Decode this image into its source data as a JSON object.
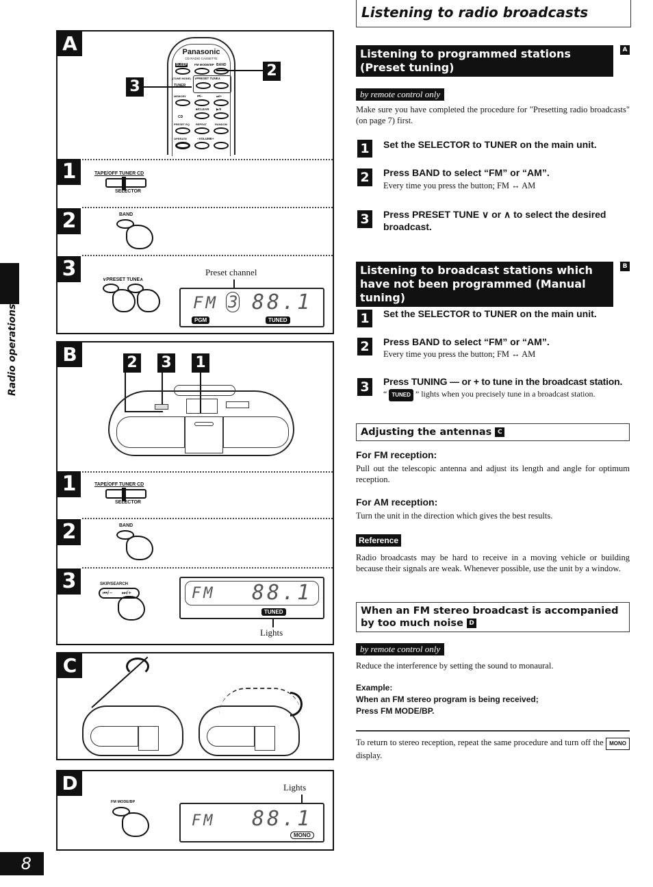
{
  "sidebar": {
    "section_label": "Radio operations",
    "page_number": "8"
  },
  "header": {
    "title": "Listening to radio broadcasts"
  },
  "preset": {
    "heading": "Listening to programmed stations (Preset tuning)",
    "figure_tag": "A",
    "remote_note": "by remote control only",
    "intro": "Make sure you have completed the procedure for \"Presetting radio broadcasts\" (on page 7) first.",
    "steps": [
      {
        "num": "1",
        "title": "Set the SELECTOR to TUNER on the main unit.",
        "detail": ""
      },
      {
        "num": "2",
        "title": "Press BAND to select “FM” or “AM”.",
        "detail": "Every time you press the button; FM ↔ AM"
      },
      {
        "num": "3",
        "title": "Press PRESET TUNE ∨ or ∧ to select the desired broadcast.",
        "detail": ""
      }
    ]
  },
  "manual": {
    "heading": "Listening to broadcast stations which have not been programmed (Manual tuning)",
    "figure_tag": "B",
    "steps": [
      {
        "num": "1",
        "title": "Set the SELECTOR to TUNER on the main unit.",
        "detail": ""
      },
      {
        "num": "2",
        "title": "Press BAND to select “FM” or “AM”.",
        "detail": "Every time you press the button; FM ↔ AM"
      },
      {
        "num": "3",
        "title": "Press TUNING — or + to tune in the broadcast station.",
        "detail_pre": "“",
        "detail_badge": "TUNED",
        "detail_post": "” lights when you precisely tune in a broadcast station."
      }
    ]
  },
  "antennas": {
    "heading": "Adjusting the antennas",
    "figure_tag": "C",
    "fm_head": "For FM reception:",
    "fm_text": "Pull out the telescopic antenna and adjust its length and angle for optimum reception.",
    "am_head": "For AM reception:",
    "am_text": "Turn the unit in the direction which gives the best results.",
    "reference_label": "Reference",
    "reference_text": "Radio broadcasts may be hard to receive in a moving vehicle or building because their signals are weak. Whenever possible, use the unit by a window."
  },
  "noise": {
    "heading": "When an FM stereo broadcast is accompanied by too much noise",
    "figure_tag": "D",
    "remote_note": "by remote control only",
    "intro": "Reduce the interference by setting the sound to monaural.",
    "example_label": "Example:",
    "example_line1": "When an FM stereo program is being received;",
    "example_line2": "Press FM MODE/BP.",
    "footer_pre": "To return to stereo reception, repeat the same procedure and turn off the",
    "footer_badge": "MONO",
    "footer_post": "display."
  },
  "figures": {
    "A": {
      "letter": "A",
      "remote": {
        "brand": "Panasonic",
        "model": "CD RADIO CASSETTE",
        "labels": [
          "SLEEP",
          "FM MODE/BP",
          "BAND",
          "(TUNE MODE)",
          "∨PRESET TUNE∧",
          "TUNER",
          "MEMORY",
          "⏮/−",
          "⏭/+",
          "CD",
          "■/CLEAR",
          "▶/II",
          "PRESET EQ",
          "REPEAT",
          "RANDOM",
          "OPERATE",
          "−VOLUME+"
        ]
      },
      "callouts": [
        "3",
        "2"
      ],
      "step1": {
        "num": "1",
        "selector_top": "TAPE/OFF  TUNER  CD",
        "selector_bottom": "SELECTOR"
      },
      "step2": {
        "num": "2",
        "button_label": "BAND"
      },
      "step3": {
        "num": "3",
        "button_label": "∨PRESET TUNE∧",
        "caption": "Preset channel",
        "lcd_band": "FM",
        "lcd_channel": "3",
        "lcd_freq": "88.1",
        "badge_left": "PGM",
        "badge_right": "TUNED"
      }
    },
    "B": {
      "letter": "B",
      "callouts": [
        "2",
        "3",
        "1"
      ],
      "step1": {
        "num": "1",
        "selector_top": "TAPE/OFF  TUNER  CD",
        "selector_bottom": "SELECTOR"
      },
      "step2": {
        "num": "2",
        "button_label": "BAND"
      },
      "step3": {
        "num": "3",
        "button_label": "SKIP/SEARCH",
        "btn_left": "⏮/−",
        "btn_right": "⏭/+",
        "lcd_band": "FM",
        "lcd_freq": "88.1",
        "badge": "TUNED",
        "caption": "Lights"
      }
    },
    "C": {
      "letter": "C"
    },
    "D": {
      "letter": "D",
      "button_label": "FM MODE/BP",
      "lcd_band": "FM",
      "lcd_freq": "88.1",
      "badge": "MONO",
      "caption": "Lights"
    }
  }
}
